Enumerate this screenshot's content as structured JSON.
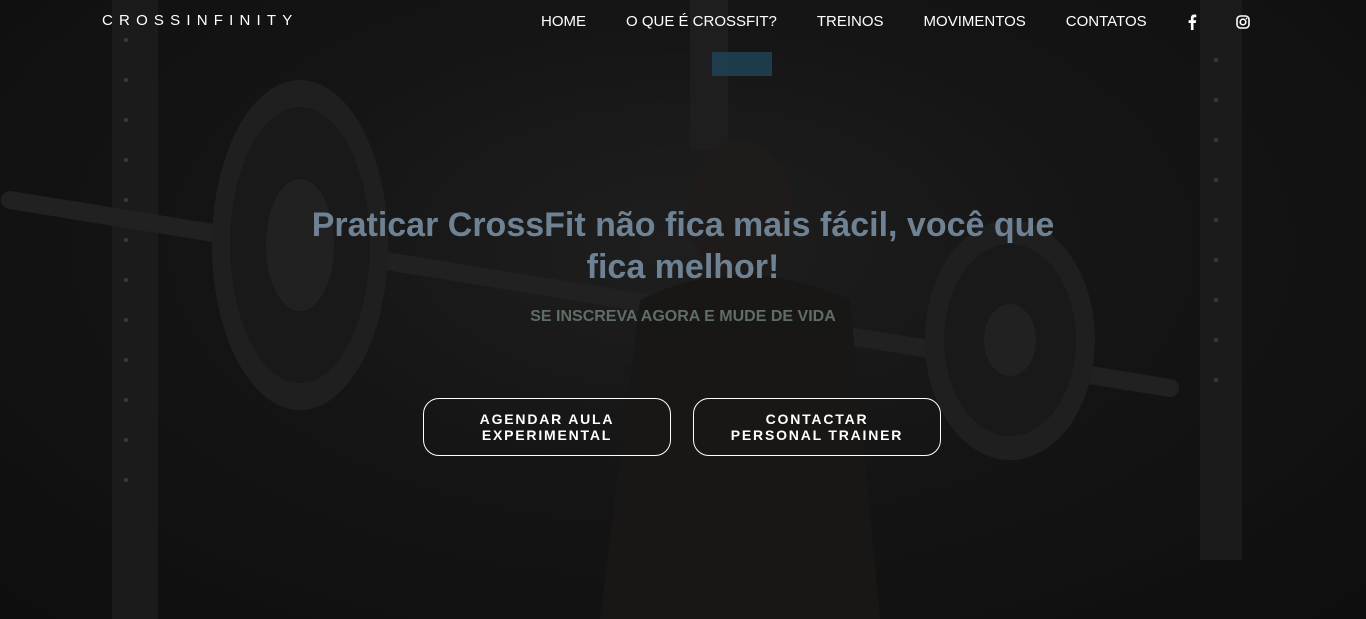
{
  "brand": {
    "name": "CROSSINFINITY"
  },
  "nav": {
    "items": [
      {
        "label": "HOME"
      },
      {
        "label": "O QUE É CROSSFIT?"
      },
      {
        "label": "TREINOS"
      },
      {
        "label": "MOVIMENTOS"
      },
      {
        "label": "CONTATOS"
      }
    ],
    "social": [
      {
        "icon": "facebook-icon"
      },
      {
        "icon": "instagram-icon"
      }
    ]
  },
  "hero": {
    "headline": "Praticar CrossFit não fica mais fácil, você que fica melhor!",
    "subline": "SE INSCREVA AGORA E MUDE DE VIDA",
    "buttons": [
      {
        "label": "AGENDAR AULA EXPERIMENTAL"
      },
      {
        "label": "CONTACTAR PERSONAL TRAINER"
      }
    ]
  },
  "colors": {
    "headline": "#6f8294",
    "subline": "#5f6e64",
    "text": "#ffffff",
    "background": "#151515"
  }
}
